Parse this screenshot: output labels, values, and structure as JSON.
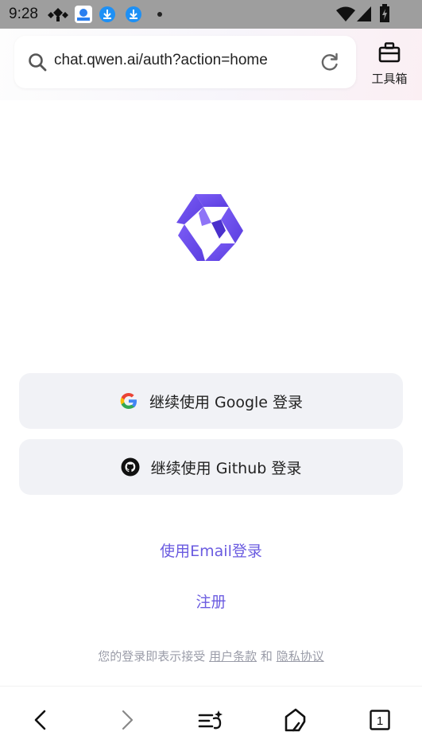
{
  "status_bar": {
    "time": "9:28",
    "icons": [
      "signal-app-icon",
      "qq-browser-icon",
      "download-icon",
      "download-icon",
      "dot-icon",
      "wifi-icon",
      "cell-signal-icon",
      "battery-icon"
    ]
  },
  "browser": {
    "url": "chat.qwen.ai/auth?action=home",
    "toolbox_label": "工具箱"
  },
  "login": {
    "google_button": "继续使用 Google 登录",
    "github_button": "继续使用 Github 登录",
    "email_link": "使用Email登录",
    "register_link": "注册",
    "terms_prefix": "您的登录即表示接受",
    "terms_link": "用户条款",
    "terms_and": "和",
    "privacy_link": "隐私协议"
  },
  "bottom_nav": {
    "tab_count": "1"
  },
  "colors": {
    "accent": "#6a5be0",
    "logo": "#6a4fe8",
    "button_bg": "#f1f2f6",
    "status_bar": "#9e9e9e"
  }
}
